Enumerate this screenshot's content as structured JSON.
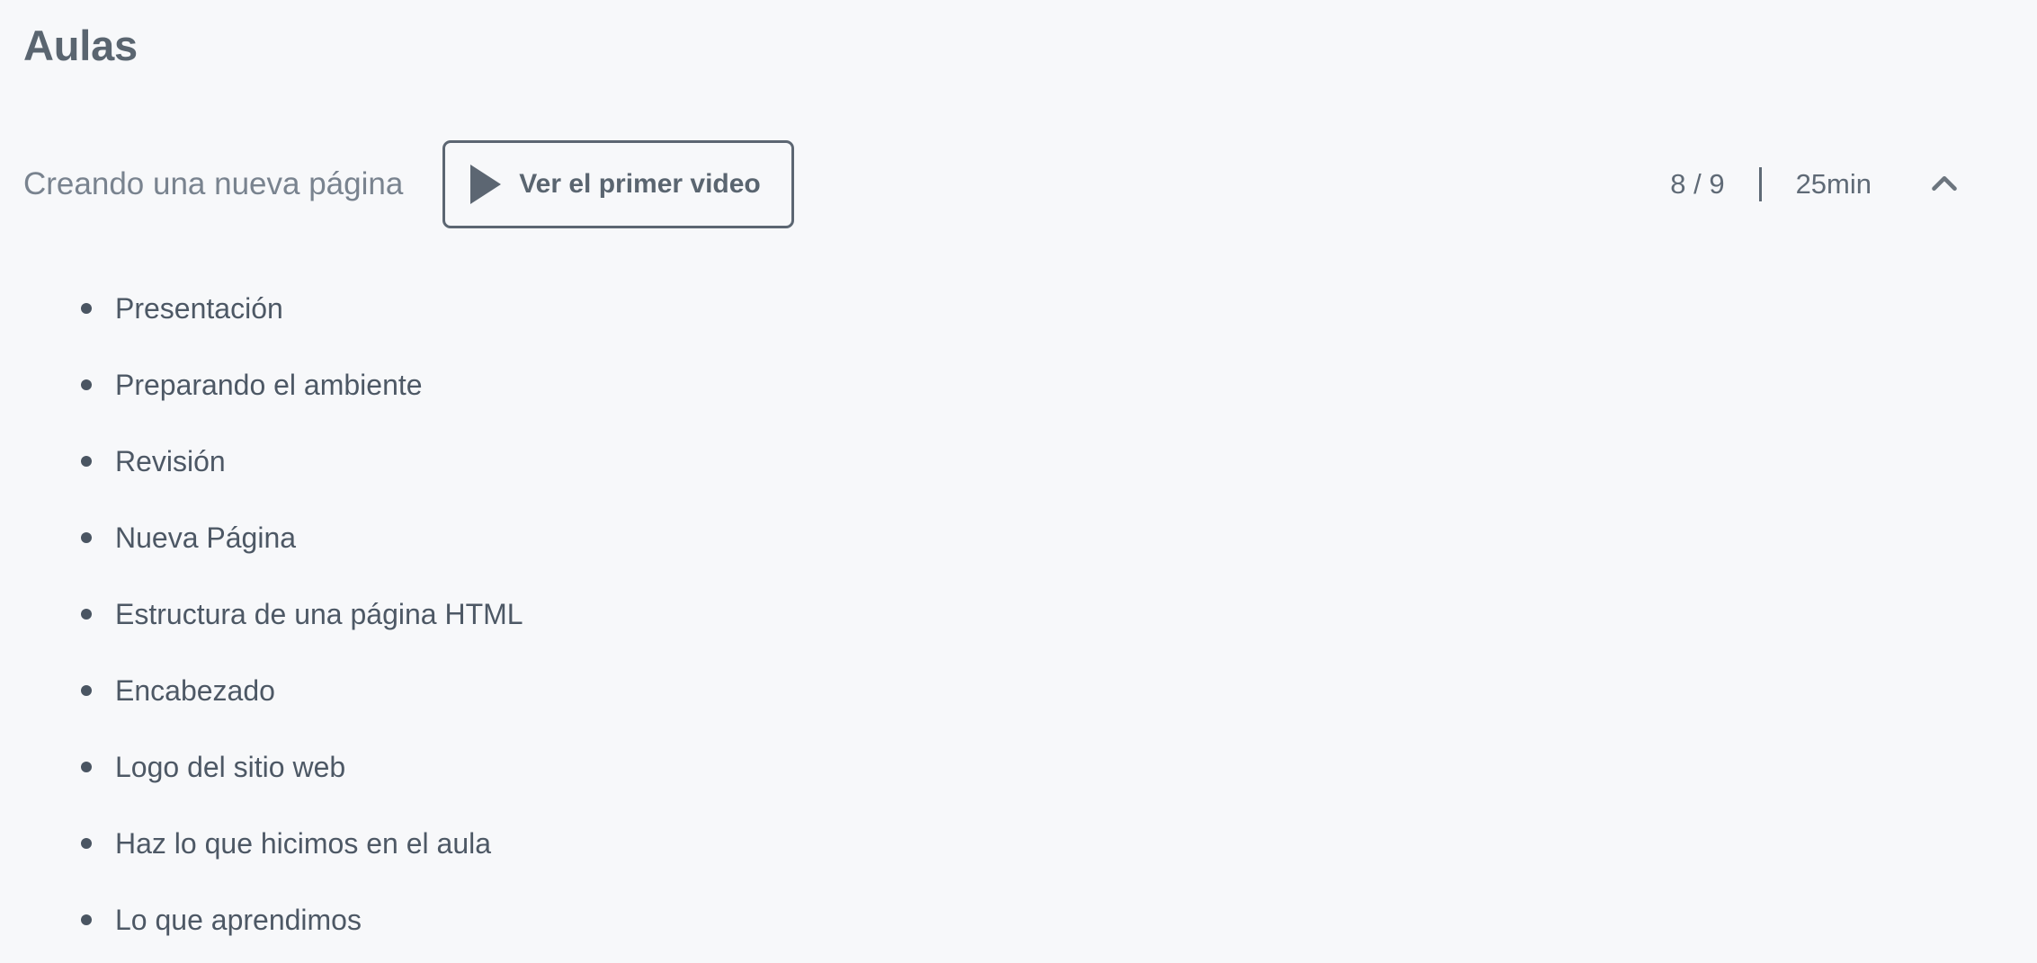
{
  "page": {
    "title": "Aulas",
    "background_color": "#f7f8fa",
    "text_color": "#4d5865",
    "accent_color": "#5c6672"
  },
  "header": {
    "subtitle": "Creando una nueva página",
    "watch_button": {
      "label": "Ver el primer video",
      "icon": "play-icon"
    },
    "meta": {
      "progress": "8 / 9",
      "divider": "|",
      "duration": "25min",
      "toggle_icon": "chevron-up-icon"
    }
  },
  "lessons": [
    {
      "label": "Presentación"
    },
    {
      "label": "Preparando el ambiente"
    },
    {
      "label": "Revisión"
    },
    {
      "label": "Nueva Página"
    },
    {
      "label": "Estructura de una página HTML"
    },
    {
      "label": "Encabezado"
    },
    {
      "label": "Logo del sitio web"
    },
    {
      "label": "Haz lo que hicimos en el aula"
    },
    {
      "label": "Lo que aprendimos"
    }
  ]
}
